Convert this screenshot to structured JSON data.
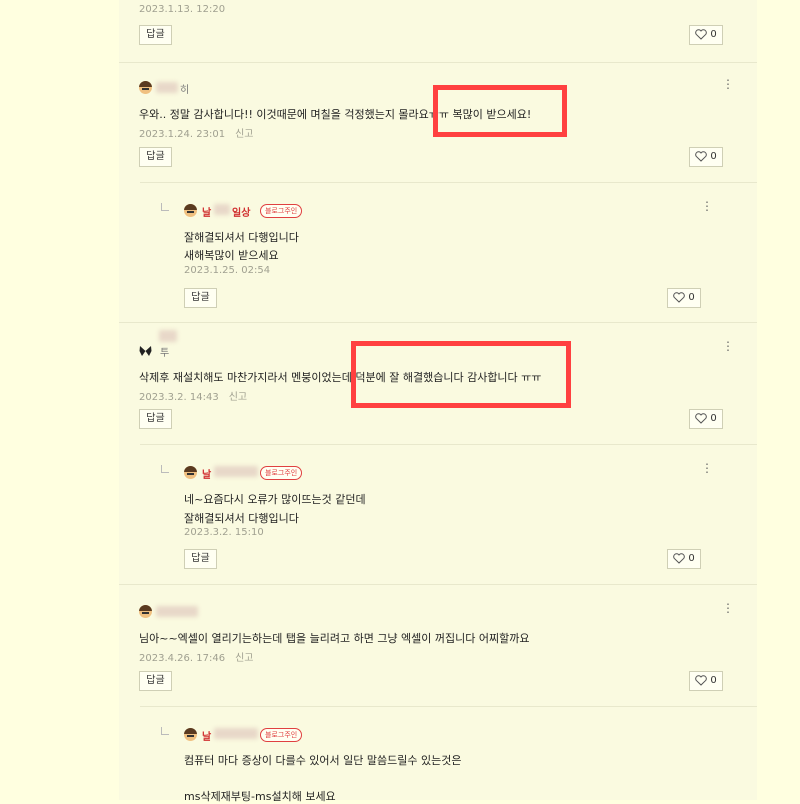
{
  "ui": {
    "reply_label": "답글",
    "report_label": "신고",
    "owner_badge": "블로그주인",
    "kebab": "⋮"
  },
  "comments": [
    {
      "timestamp": "2023.1.13. 12:20",
      "likes": "0"
    },
    {
      "author": "히",
      "text": "우와.. 정말 감사합니다!! 이것때문에 며칠을 걱정했는지 몰라요ㅠㅠ 복많이 받으세요!",
      "timestamp": "2023.1.24. 23:01",
      "likes": "0",
      "reply": {
        "author": "날",
        "author_suffix": "일상",
        "line1": "잘해결되셔서 다행입니다",
        "line2": "새해복많이 받으세요",
        "timestamp": "2023.1.25. 02:54",
        "likes": "0"
      }
    },
    {
      "author": "투",
      "text": "삭제후 재설치해도 마찬가지라서 멘붕이었는데 덕분에 잘 해결했습니다 감사합니다 ㅠㅠ",
      "timestamp": "2023.3.2. 14:43",
      "likes": "0",
      "reply": {
        "author": "날",
        "line1": "네~요즘다시 오류가 많이뜨는것 같던데",
        "line2": "잘해결되셔서 다행입니다",
        "timestamp": "2023.3.2. 15:10",
        "likes": "0"
      }
    },
    {
      "text": "님아~~엑셀이 열리기는하는데 탭을 늘리려고 하면 그냥 엑셀이 꺼집니다 어찌할까요",
      "timestamp": "2023.4.26. 17:46",
      "likes": "0",
      "reply": {
        "author": "날",
        "line1": "컴퓨터 마다 증상이 다를수 있어서 일단 말씀드릴수 있는것은",
        "line2": "ms삭제재부팅-ms설치해 보세요"
      }
    }
  ],
  "colors": {
    "page_bg": "#ffffe0",
    "column_bg": "#fafae0",
    "highlight": "#ff4040",
    "owner": "#d03030"
  }
}
